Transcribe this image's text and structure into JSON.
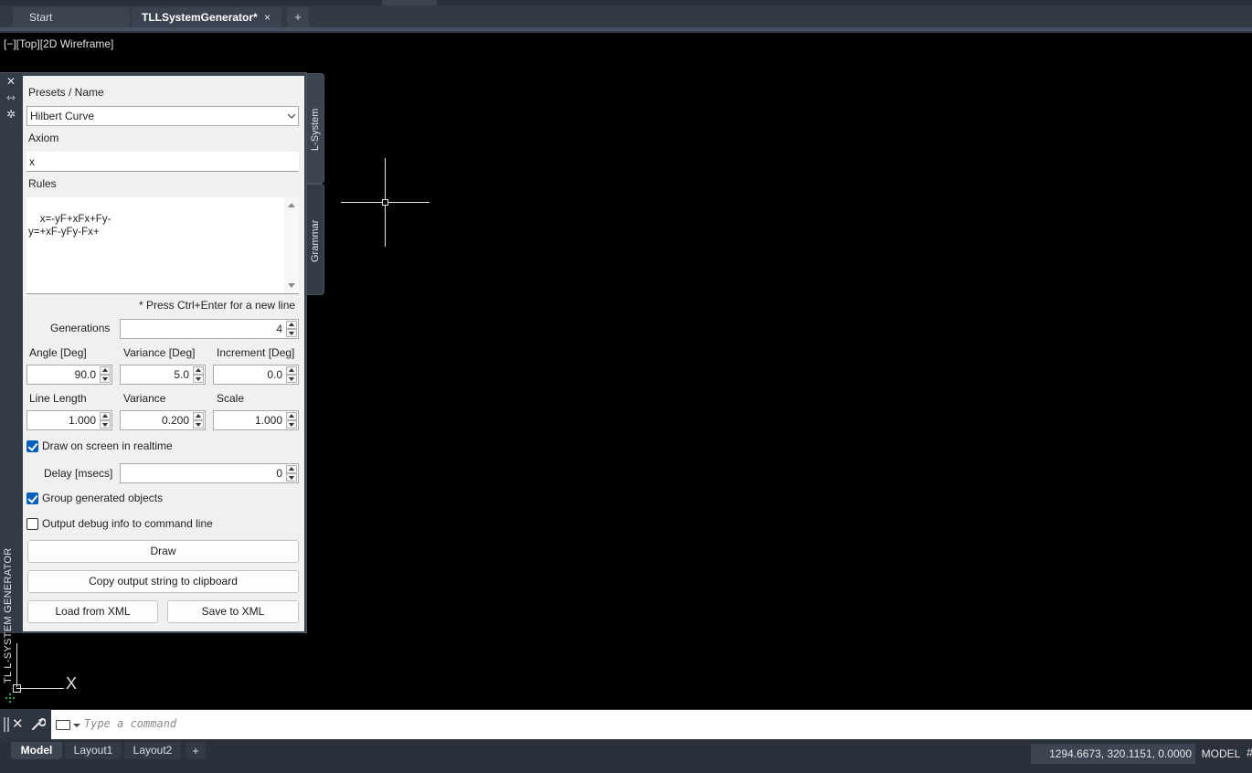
{
  "tabs": {
    "start": "Start",
    "active": "TLLSystemGenerator*",
    "close_glyph": "×",
    "new_glyph": "+"
  },
  "viewport": {
    "label": "[−][Top][2D Wireframe]",
    "ucs_axis_label": "X"
  },
  "palette": {
    "title": "TL L-SYSTEM GENERATOR",
    "icons": [
      "close-icon",
      "auto-hide-icon",
      "properties-icon"
    ],
    "side_tabs": [
      "L-System",
      "Grammar"
    ]
  },
  "form": {
    "presets_label": "Presets / Name",
    "preset_value": "Hilbert Curve",
    "axiom_label": "Axiom",
    "axiom_value": "x",
    "rules_label": "Rules",
    "rules_value": "x=-yF+xFx+Fy-\ny=+xF-yFy-Fx+",
    "rules_hint": "* Press Ctrl+Enter for a new line",
    "generations_label": "Generations",
    "generations_value": "4",
    "angle_label": "Angle [Deg]",
    "angle_value": "90.0",
    "variance_deg_label": "Variance [Deg]",
    "variance_deg_value": "5.0",
    "increment_label": "Increment [Deg]",
    "increment_value": "0.0",
    "line_length_label": "Line Length",
    "line_length_value": "1.000",
    "variance_label": "Variance",
    "variance_value": "0.200",
    "scale_label": "Scale",
    "scale_value": "1.000",
    "draw_realtime_label": "Draw on screen in realtime",
    "draw_realtime_checked": true,
    "delay_label": "Delay [msecs]",
    "delay_value": "0",
    "group_label": "Group generated objects",
    "group_checked": true,
    "debug_label": "Output debug info to command line",
    "debug_checked": false,
    "draw_button": "Draw",
    "copy_button": "Copy output string to clipboard",
    "load_button": "Load from XML",
    "save_button": "Save to XML"
  },
  "command_line": {
    "placeholder": "Type a command",
    "close_glyph": "✕"
  },
  "status": {
    "layout_tabs": [
      "Model",
      "Layout1",
      "Layout2"
    ],
    "add_tab": "+",
    "coordinates": "1294.6673, 320.1151, 0.0000",
    "space": "MODEL",
    "grid_glyph": "#"
  },
  "colors": {
    "accent": "#005fb8",
    "viewport_bg": "#000000",
    "chrome_bg": "#333a44",
    "panel_bg": "#f0f0f0"
  }
}
